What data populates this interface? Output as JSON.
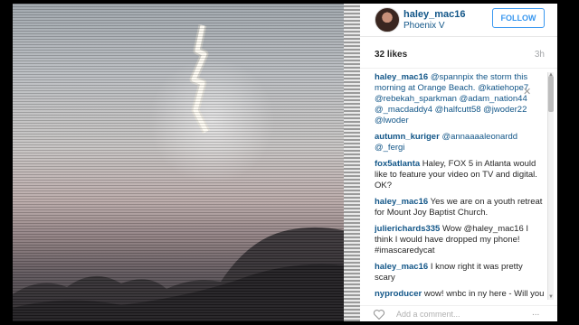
{
  "post": {
    "username": "haley_mac16",
    "location": "Phoenix V",
    "follow_label": "FOLLOW",
    "likes": "32 likes",
    "time": "3h"
  },
  "comments": [
    {
      "user": "haley_mac16",
      "text": "@spannpix the storm this morning at Orange Beach. @katiehope7 @rebekah_sparkman @adam_nation44 @_macdaddy4 @halfcutt58 @jwoder22 @lwoder"
    },
    {
      "user": "autumn_kuriger",
      "text": "@annaaaaleonardd @_fergi"
    },
    {
      "user": "fox5atlanta",
      "text": "Haley, FOX 5 in Atlanta would like to feature your video on TV and digital. OK?"
    },
    {
      "user": "haley_mac16",
      "text": "Yes we are on a youth retreat for Mount Joy Baptist Church."
    },
    {
      "user": "julierichards335",
      "text": "Wow @haley_mac16 I think I would have dropped my phone! #imascaredycat"
    },
    {
      "user": "haley_mac16",
      "text": "I know right it was pretty scary"
    },
    {
      "user": "nyproducer",
      "text": "wow! wnbc in ny here - Will you give us the rights to use this post? If"
    }
  ],
  "footer": {
    "add_comment_placeholder": "Add a comment...",
    "more": "..."
  },
  "icons": {
    "close": "close-icon",
    "heart": "heart-icon",
    "more": "more-options-icon"
  },
  "colors": {
    "link": "#125688",
    "follow": "#3897f0"
  }
}
